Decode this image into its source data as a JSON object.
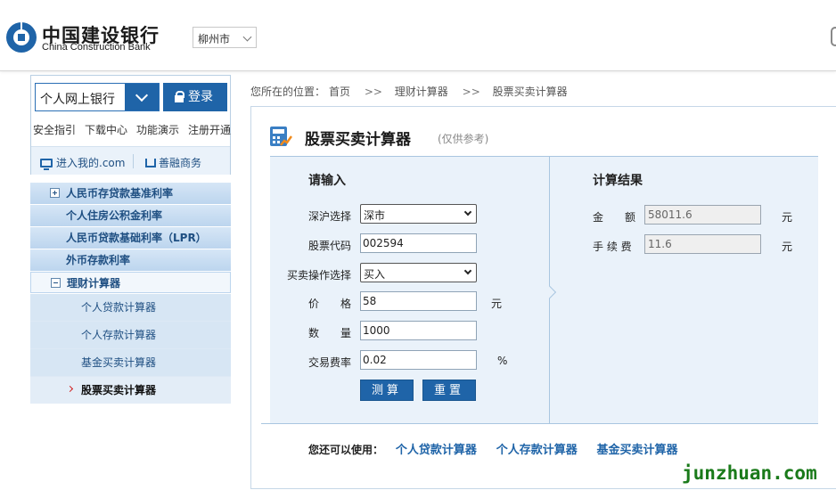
{
  "header": {
    "logo_cn": "中国建设银行",
    "logo_en": "China Construction Bank",
    "city": "柳州市"
  },
  "login": {
    "bank_select": "个人网上银行",
    "login_button": "登录",
    "quick_links": [
      "安全指引",
      "下载中心",
      "功能演示",
      "注册开通"
    ],
    "enter_my": "进入我的.com",
    "shanrong": "善融商务"
  },
  "menu": {
    "items": [
      "人民币存贷款基准利率",
      "个人住房公积金利率",
      "人民币贷款基础利率（LPR）",
      "外币存款利率"
    ],
    "open_item": "理财计算器",
    "sub_items": [
      "个人贷款计算器",
      "个人存款计算器",
      "基金买卖计算器"
    ],
    "active_sub": "股票买卖计算器"
  },
  "breadcrumb": {
    "prefix": "您所在的位置：",
    "items": [
      "首页",
      "理财计算器",
      "股票买卖计算器"
    ],
    "sep": ">>"
  },
  "calculator": {
    "title": "股票买卖计算器",
    "subtitle": "(仅供参考)",
    "input_title": "请输入",
    "result_title": "计算结果",
    "fields": {
      "market_label": "深沪选择",
      "market_value": "深市",
      "code_label": "股票代码",
      "code_value": "002594",
      "op_label": "买卖操作选择",
      "op_value": "买入",
      "price_label": "价　　格",
      "price_value": "58",
      "price_unit": "元",
      "qty_label": "数　　量",
      "qty_value": "1000",
      "fee_label": "交易费率",
      "fee_value": "0.02",
      "fee_unit": "%"
    },
    "buttons": {
      "calc": "测算",
      "reset": "重置"
    },
    "results": {
      "amount_label": "金　　额",
      "amount_value": "58011.6",
      "amount_unit": "元",
      "fee_label": "手 续 费",
      "fee_value": "11.6",
      "fee_unit": "元"
    }
  },
  "footer": {
    "lead": "您还可以使用：",
    "links": [
      "个人贷款计算器",
      "个人存款计算器",
      "基金买卖计算器"
    ]
  },
  "watermark": "junzhuan.com",
  "colors": {
    "brand_blue": "#1f64a8",
    "panel_bg": "#eaf2fa",
    "watermark_green": "#1a7a1a",
    "active_marker": "#d01c1c"
  }
}
